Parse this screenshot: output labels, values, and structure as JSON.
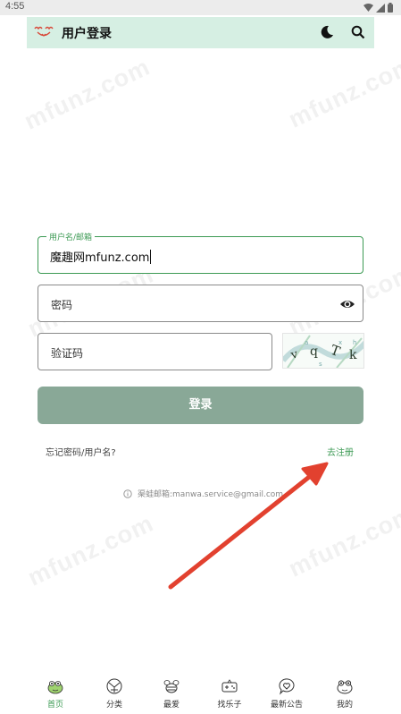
{
  "status_bar": {
    "time": "4:55"
  },
  "app_bar": {
    "title": "用户登录"
  },
  "watermark": "mfunz.com",
  "form": {
    "username": {
      "label": "用户名/邮箱",
      "value": "魔趣网mfunz.com"
    },
    "password": {
      "placeholder": "密码"
    },
    "captcha": {
      "placeholder": "验证码"
    },
    "login_label": "登录",
    "forgot_label": "忘记密码/用户名?",
    "register_label": "去注册"
  },
  "contact": {
    "text": "渠蛙邮箱:manwa.service@gmail.com"
  },
  "bottom_nav": [
    {
      "label": "首页",
      "icon": "home-mascot-icon",
      "active": true
    },
    {
      "label": "分类",
      "icon": "category-icon",
      "active": false
    },
    {
      "label": "最爱",
      "icon": "favorite-bee-icon",
      "active": false
    },
    {
      "label": "找乐子",
      "icon": "gamepad-icon",
      "active": false
    },
    {
      "label": "最新公告",
      "icon": "announcement-heart-icon",
      "active": false
    },
    {
      "label": "我的",
      "icon": "profile-frog-icon",
      "active": false
    }
  ],
  "colors": {
    "accent": "#3c9a54",
    "app_bar_bg": "#d6efe3",
    "login_button": "#89a897",
    "arrow": "#e2412f"
  }
}
